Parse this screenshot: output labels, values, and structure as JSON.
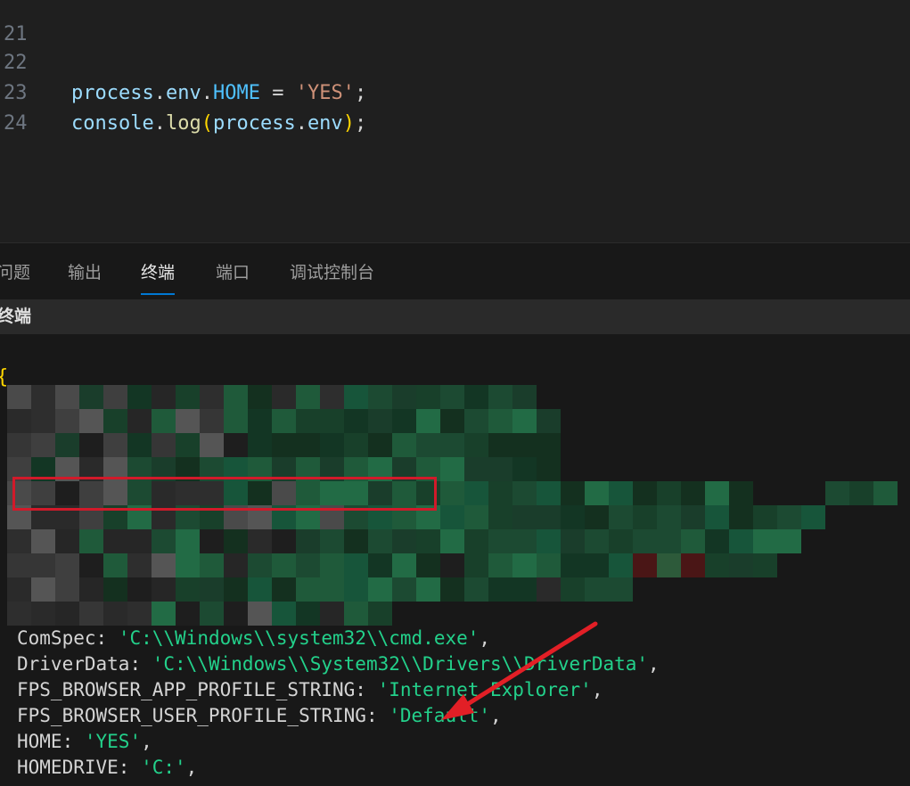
{
  "editor": {
    "lines": [
      {
        "num": "21",
        "code": ""
      },
      {
        "num": "22",
        "code": "process.env.HOME = 'YES';"
      },
      {
        "num": "23",
        "code": "console.log(process.env);"
      },
      {
        "num": "24",
        "code": ""
      }
    ],
    "line22": {
      "a": "process",
      "b": ".",
      "c": "env",
      "d": ".",
      "e": "HOME",
      "f": " = ",
      "g": "'YES'",
      "h": ";"
    },
    "line23": {
      "a": "console",
      "b": ".",
      "c": "log",
      "d": "(",
      "e": "process",
      "f": ".",
      "g": "env",
      "h": ")",
      "i": ";"
    }
  },
  "panel": {
    "tabs": [
      {
        "label": "问题",
        "active": false
      },
      {
        "label": "输出",
        "active": false
      },
      {
        "label": "终端",
        "active": true
      },
      {
        "label": "端口",
        "active": false
      },
      {
        "label": "调试控制台",
        "active": false
      }
    ],
    "terminal_header": "终端"
  },
  "terminal": {
    "open_brace": "{",
    "env_lines": [
      {
        "key": "ComSpec",
        "value": "'C:\\\\Windows\\\\system32\\\\cmd.exe'"
      },
      {
        "key": "DriverData",
        "value": "'C:\\\\Windows\\\\System32\\\\Drivers\\\\DriverData'"
      },
      {
        "key": "FPS_BROWSER_APP_PROFILE_STRING",
        "value": "'Internet Explorer'"
      },
      {
        "key": "FPS_BROWSER_USER_PROFILE_STRING",
        "value": "'Default'"
      },
      {
        "key": "HOME",
        "value": "'YES'"
      },
      {
        "key": "HOMEDRIVE",
        "value": "'C:'"
      }
    ]
  },
  "annotation": {
    "box_color": "#d11a2a",
    "arrow_color": "#e21f26"
  }
}
